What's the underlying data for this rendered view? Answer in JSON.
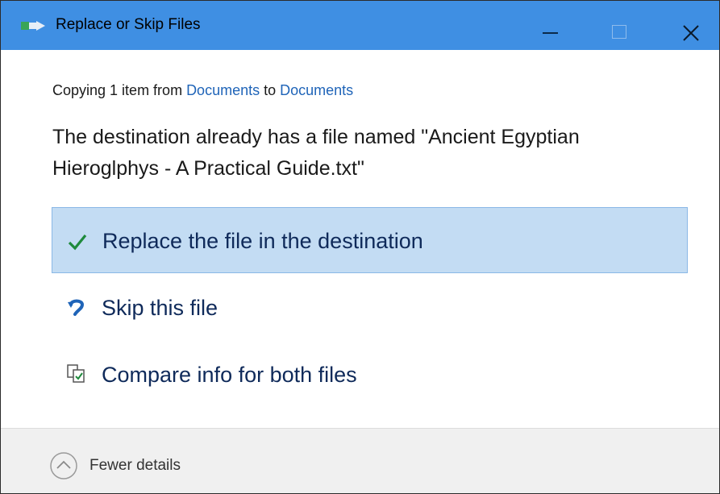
{
  "window": {
    "title": "Replace or Skip Files"
  },
  "subtitle": {
    "prefix": "Copying 1 item from ",
    "source": "Documents",
    "middle": " to ",
    "destination": "Documents"
  },
  "heading": "The destination already has a file named \"Ancient Egyptian Hieroglphys - A Practical Guide.txt\"",
  "options": [
    {
      "label": "Replace the file in the destination",
      "icon": "checkmark-icon",
      "selected": true
    },
    {
      "label": "Skip this file",
      "icon": "skip-arrow-icon",
      "selected": false
    },
    {
      "label": "Compare info for both files",
      "icon": "compare-files-icon",
      "selected": false
    }
  ],
  "footer": {
    "details_label": "Fewer details",
    "details_icon": "chevron-up-circle-icon"
  },
  "colors": {
    "titlebar": "#3f8fe3",
    "selection": "#c3dcf3",
    "link": "#1f64b8",
    "check": "#1e8a3c"
  }
}
